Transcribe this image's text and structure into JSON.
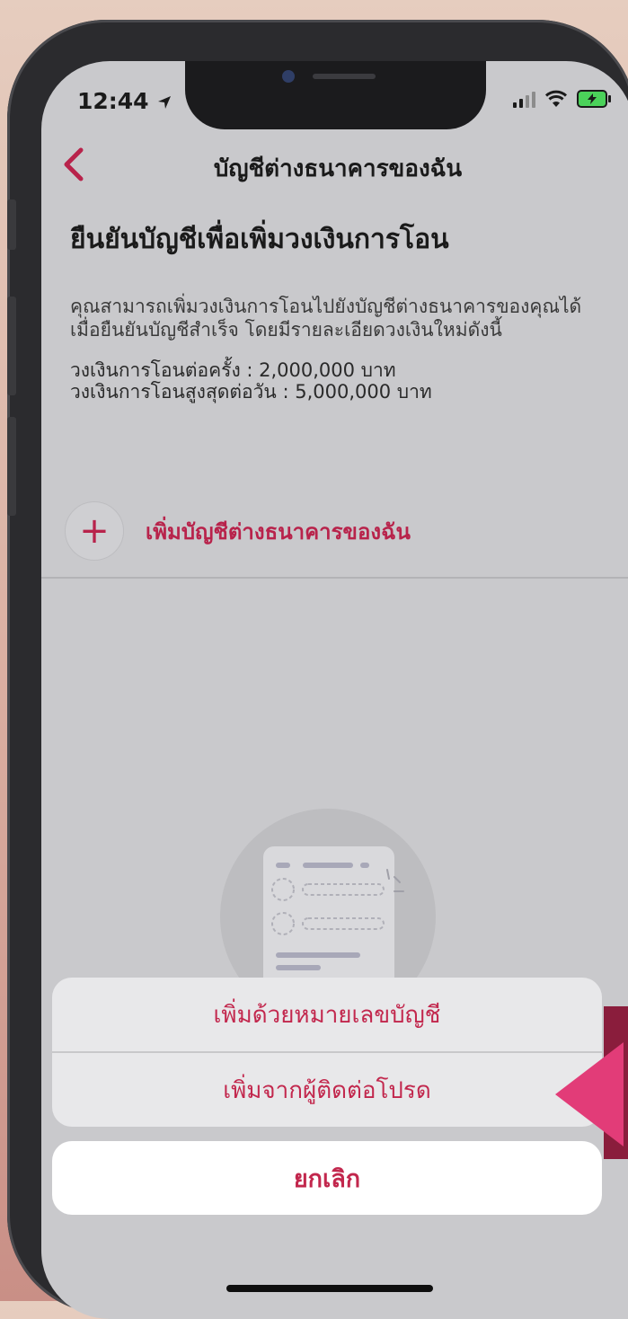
{
  "status_bar": {
    "time": "12:44",
    "location_icon": "location-arrow-icon",
    "signal_icon": "cellular-signal-icon",
    "wifi_icon": "wifi-icon",
    "battery_icon": "battery-charging-icon",
    "battery_color": "#4bd25a"
  },
  "nav": {
    "back_icon": "chevron-left-icon",
    "title": "บัญชีต่างธนาคารของฉัน"
  },
  "main": {
    "heading": "ยืนยันบัญชีเพื่อเพิ่มวงเงินการโอน",
    "description": "คุณสามารถเพิ่มวงเงินการโอนไปยังบัญชีต่างธนาคารของคุณได้เมื่อยืนยันบัญชีสำเร็จ โดยมีรายละเอียดวงเงินใหม่ดังนี้",
    "limit_per_transfer": "วงเงินการโอนต่อครั้ง : 2,000,000 บาท",
    "limit_per_day": "วงเงินการโอนสูงสุดต่อวัน : 5,000,000 บาท",
    "add_icon": "plus-icon",
    "add_label": "เพิ่มบัญชีต่างธนาคารของฉัน",
    "illustration": "empty-list-illustration"
  },
  "action_sheet": {
    "option_account_number": "เพิ่มด้วยหมายเลขบัญชี",
    "option_favorites": "เพิ่มจากผู้ติดต่อโปรด",
    "cancel": "ยกเลิก"
  },
  "colors": {
    "accent": "#c2274d",
    "overlay": "#c9c9cc",
    "pointer": "#e23c78"
  }
}
